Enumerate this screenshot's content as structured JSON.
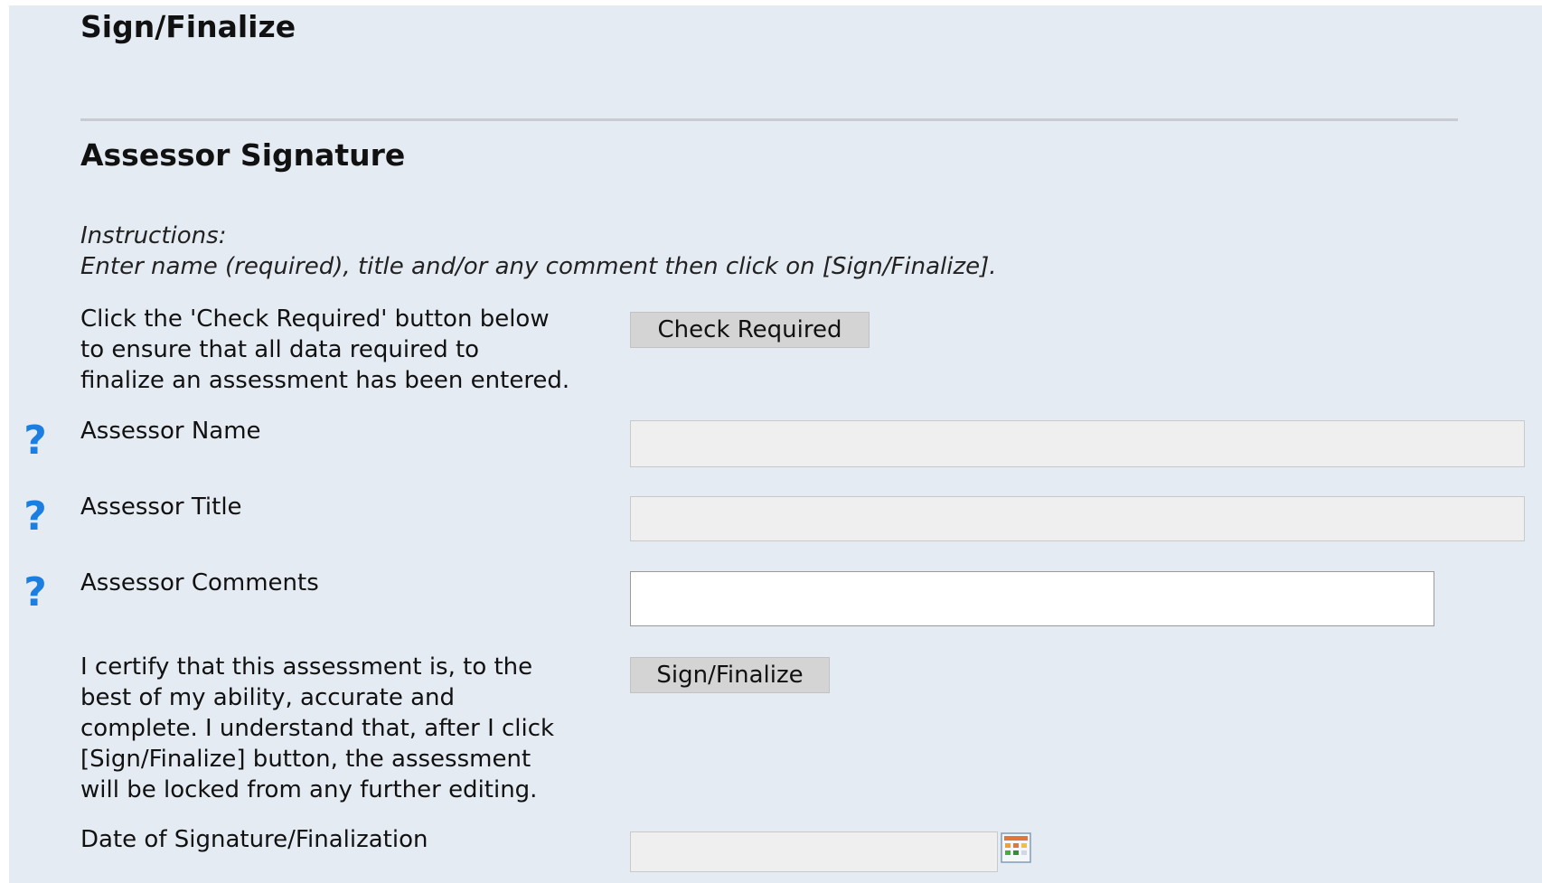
{
  "page": {
    "title": "Sign/Finalize"
  },
  "section": {
    "title": "Assessor Signature"
  },
  "instructions": {
    "label": "Instructions:",
    "text": "Enter name (required), title and/or any comment then click on [Sign/Finalize]."
  },
  "check": {
    "lines": [
      "Click the 'Check Required' button below",
      "to ensure that all data required to",
      "finalize an assessment has been entered."
    ],
    "button_label": "Check Required"
  },
  "fields": {
    "name": {
      "label": "Assessor Name",
      "value": ""
    },
    "title": {
      "label": "Assessor Title",
      "value": ""
    },
    "comments": {
      "label": "Assessor Comments",
      "value": ""
    }
  },
  "certify": {
    "lines": [
      "I certify that this assessment is, to the",
      "best of my ability, accurate and",
      "complete. I understand that, after I click",
      "[Sign/Finalize] button, the assessment",
      "will be locked from any further editing."
    ],
    "button_label": "Sign/Finalize"
  },
  "date": {
    "label": "Date of Signature/Finalization",
    "value": ""
  },
  "icons": {
    "help": "help-question-icon",
    "calendar": "calendar-icon"
  },
  "colors": {
    "panel": "#e5ebf3",
    "help_icon": "#1a7fe0",
    "button": "#d4d4d4"
  }
}
